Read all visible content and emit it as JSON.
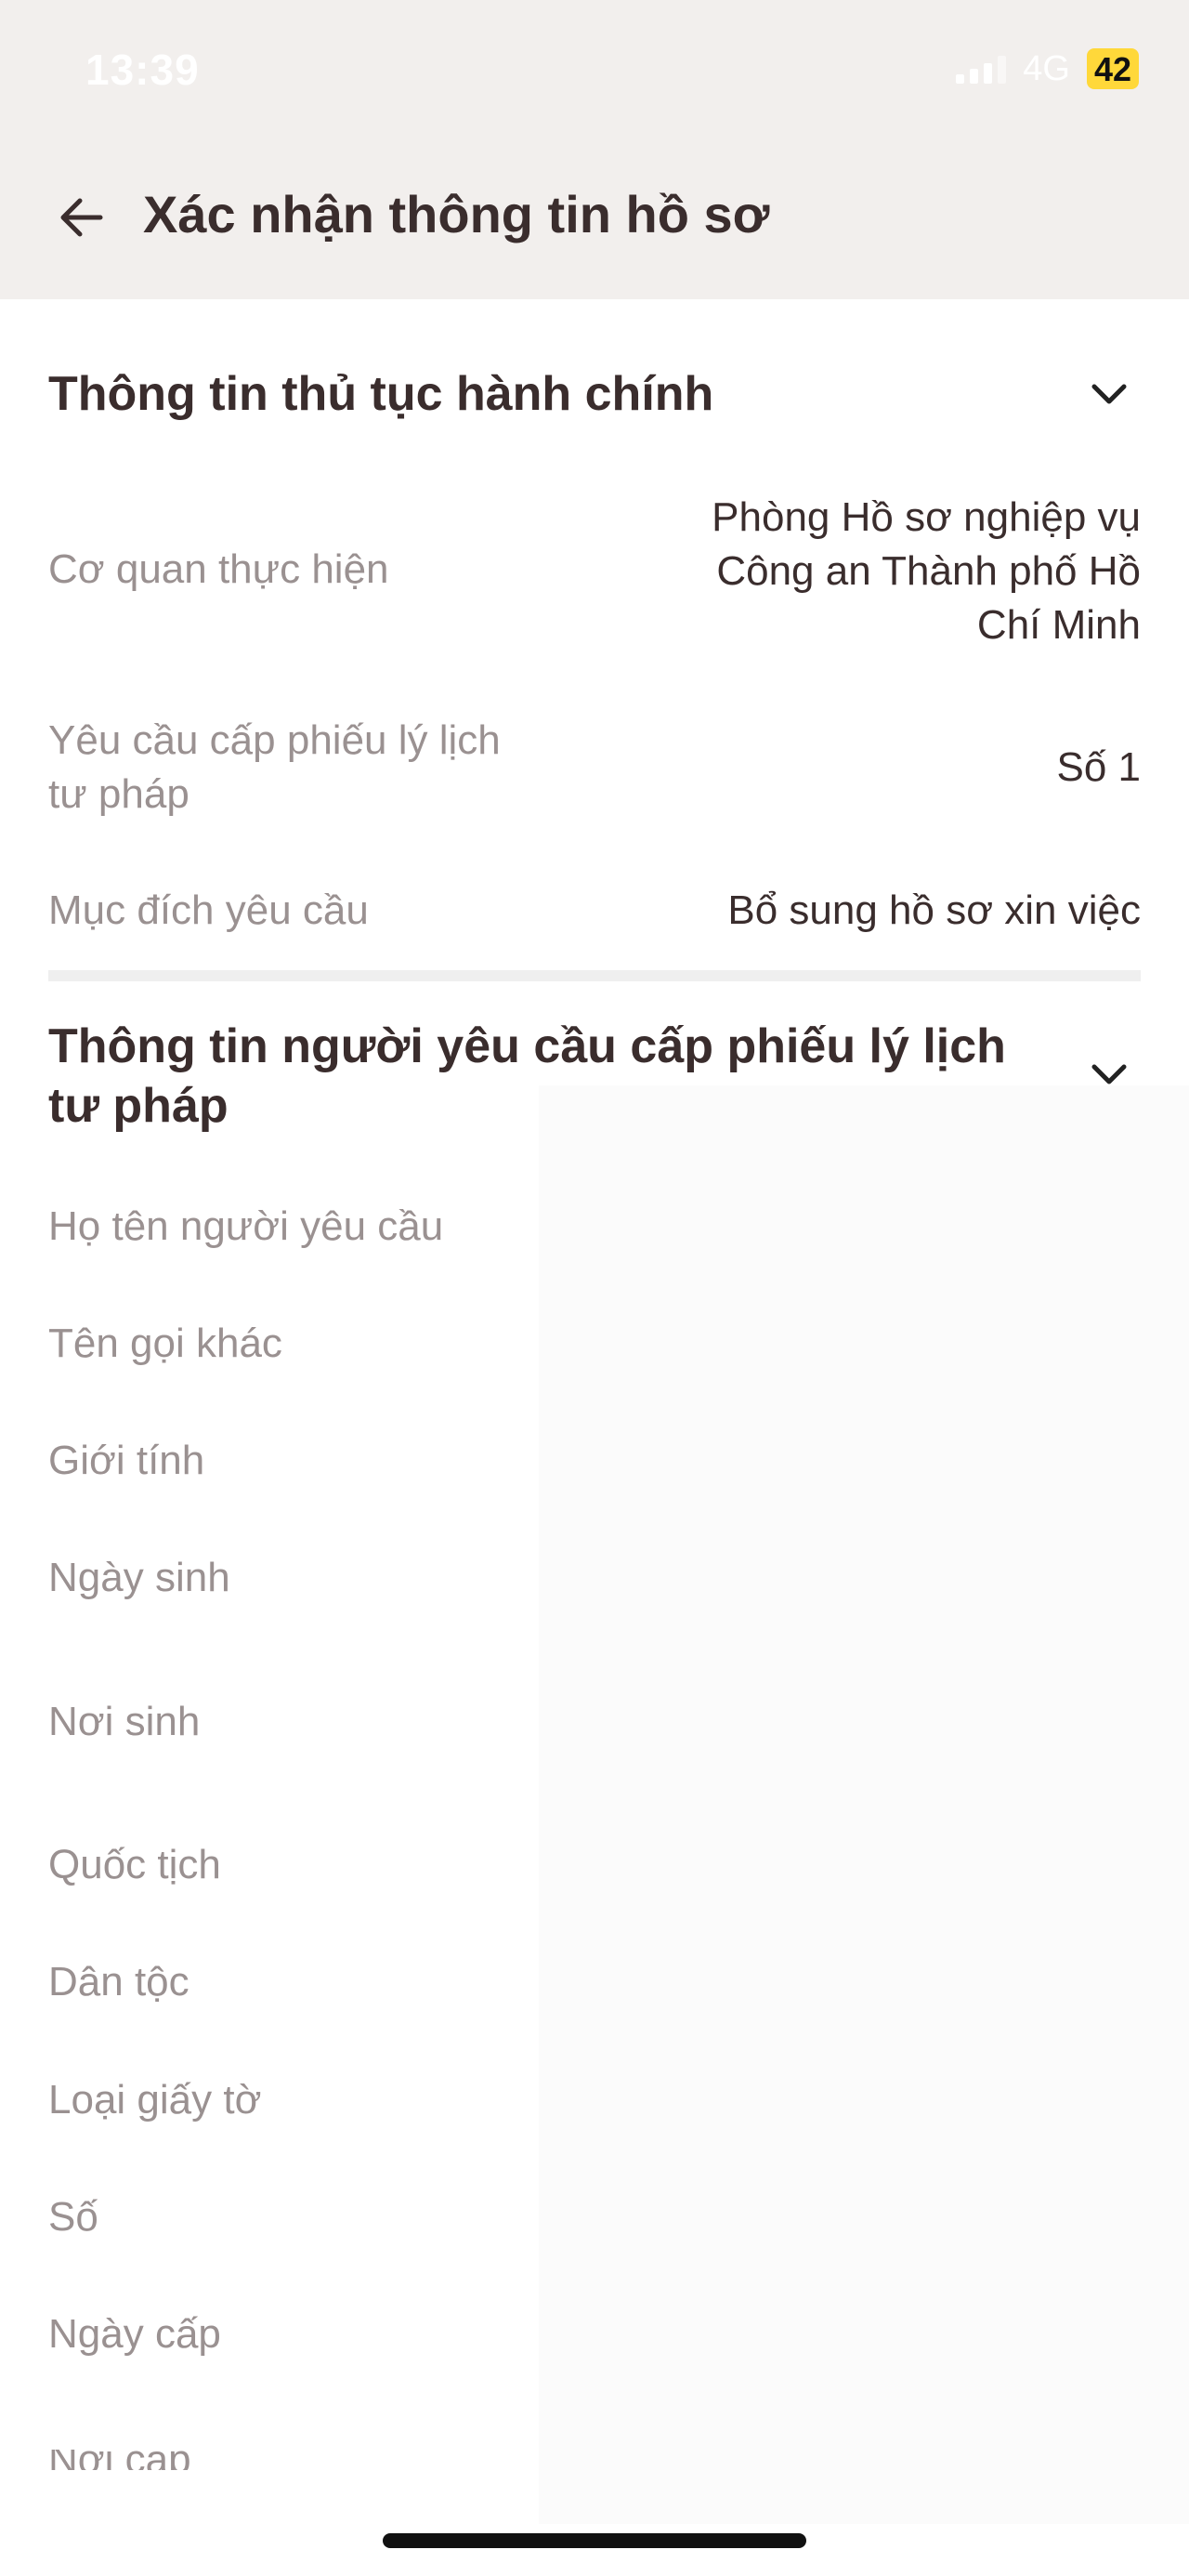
{
  "status_bar": {
    "time": "13:39",
    "network": "4G",
    "battery": "42"
  },
  "header": {
    "title": "Xác nhận thông tin hồ sơ",
    "back_icon": "arrow-left-icon"
  },
  "section_admin": {
    "title": "Thông tin thủ tục hành chính",
    "fields": [
      {
        "label": "Cơ quan thực hiện",
        "value_lines": [
          "Phòng Hồ sơ nghiệp vụ",
          "Công an Thành phố Hồ",
          "Chí Minh"
        ]
      },
      {
        "label_lines": [
          "Yêu cầu cấp phiếu lý lịch",
          "tư pháp"
        ],
        "value": "Số 1"
      },
      {
        "label": "Mục đích yêu cầu",
        "value": "Bổ sung hồ sơ xin việc"
      }
    ]
  },
  "section_requester": {
    "title_lines": [
      "Thông tin người yêu cầu cấp phiếu lý lịch",
      "tư pháp"
    ],
    "fields": [
      {
        "label": "Họ tên người yêu cầu"
      },
      {
        "label": "Tên gọi khác"
      },
      {
        "label": "Giới tính"
      },
      {
        "label": "Ngày sinh"
      },
      {
        "label": "Nơi sinh"
      },
      {
        "label": "Quốc tịch"
      },
      {
        "label": "Dân tộc"
      },
      {
        "label": "Loại giấy tờ"
      },
      {
        "label": "Số"
      },
      {
        "label": "Ngày cấp"
      },
      {
        "label": "Nơi cấp"
      }
    ]
  }
}
